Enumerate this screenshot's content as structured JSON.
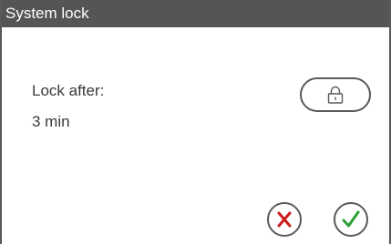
{
  "window": {
    "title": "System lock"
  },
  "settings": {
    "lock_after_label": "Lock after:",
    "lock_after_value": "3 min"
  },
  "buttons": {
    "lock_icon": "padlock-icon",
    "cancel_icon": "cross-icon",
    "confirm_icon": "check-icon"
  },
  "colors": {
    "titlebar_bg": "#555555",
    "titlebar_text": "#ffffff",
    "border": "#5a5a5a",
    "cancel": "#cc1e1e",
    "confirm": "#2f9e36"
  }
}
